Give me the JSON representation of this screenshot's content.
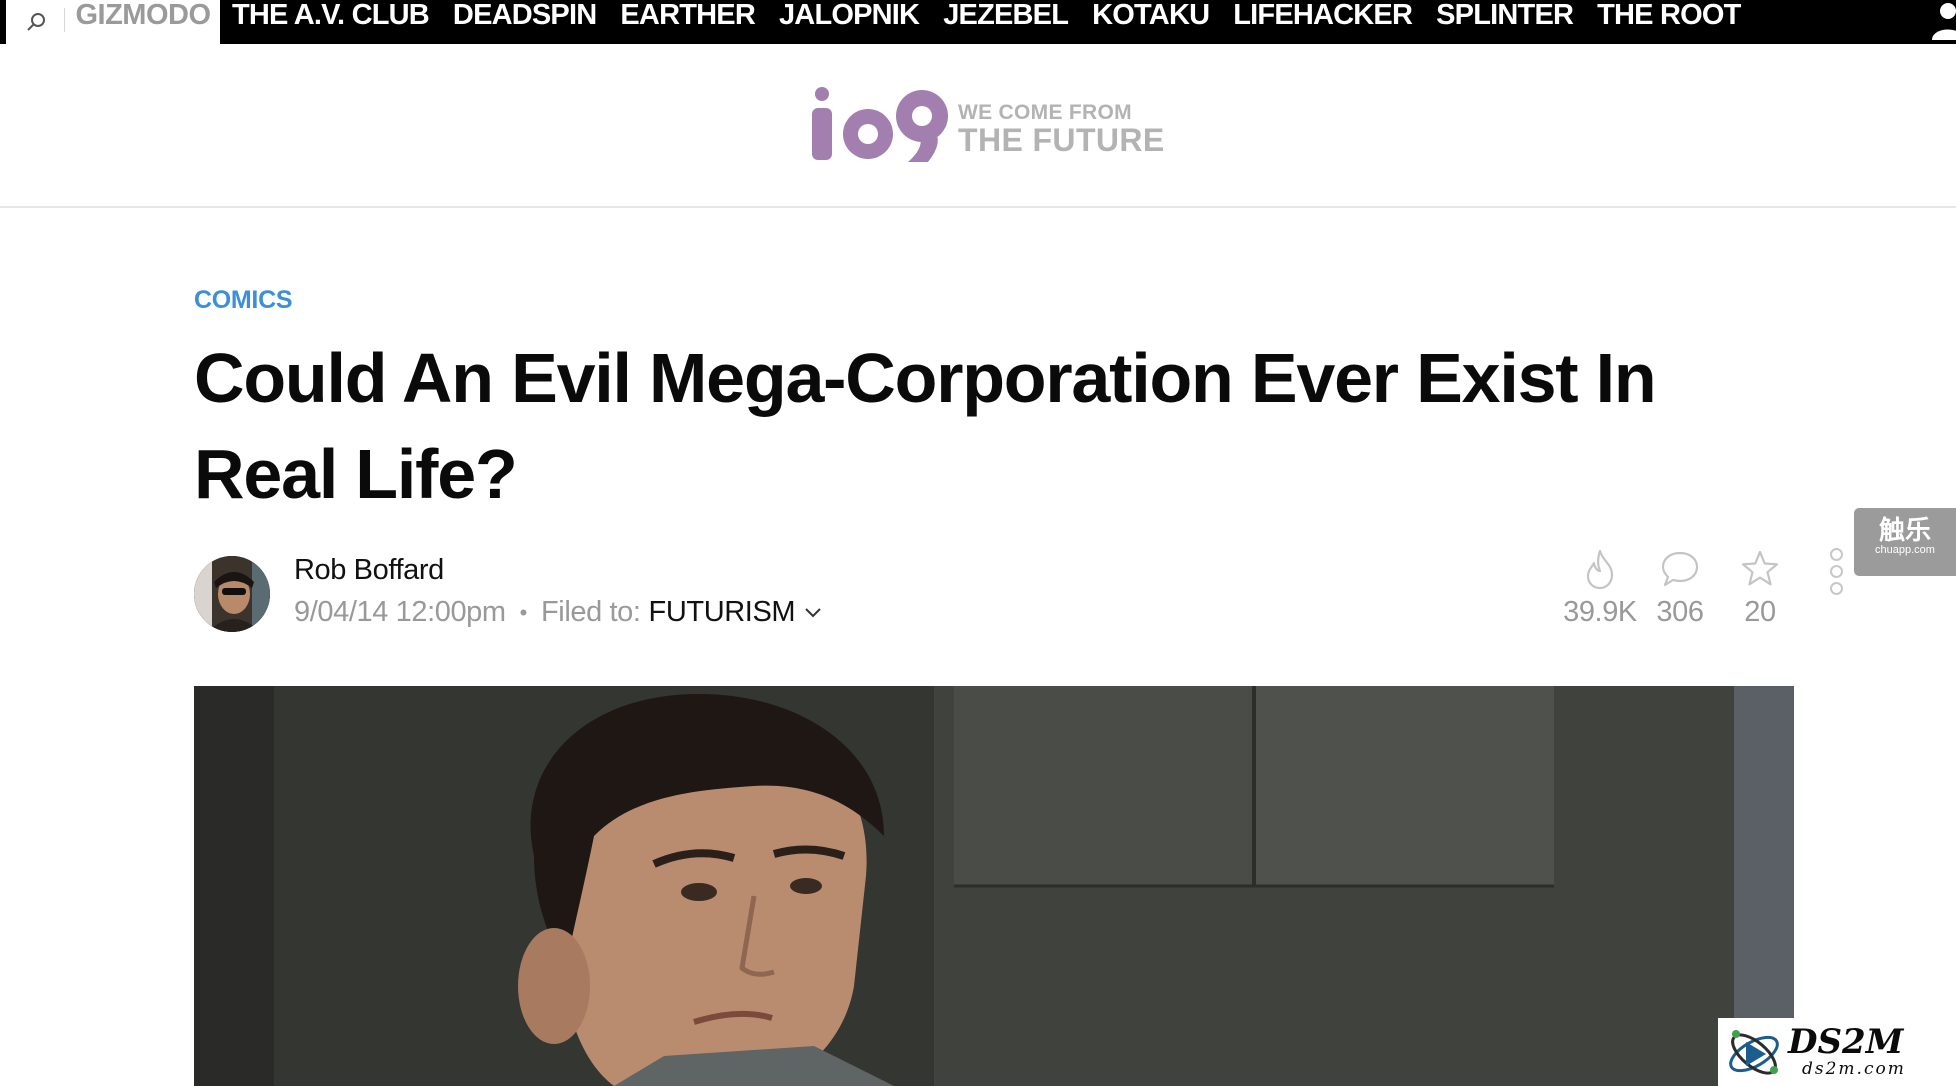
{
  "topnav": {
    "search_icon": "search-icon",
    "current_site": "GIZMODO",
    "sites": [
      "THE A.V. CLUB",
      "DEADSPIN",
      "EARTHER",
      "JALOPNIK",
      "JEZEBEL",
      "KOTAKU",
      "LIFEHACKER",
      "SPLINTER",
      "THE ROOT"
    ],
    "user_icon": "user-icon"
  },
  "brand": {
    "logo_text": "io9",
    "tagline_line1": "WE COME FROM",
    "tagline_line2": "THE FUTURE",
    "logo_color": "#a37fb0",
    "tagline_color": "#b3b3b3"
  },
  "article": {
    "category": "COMICS",
    "category_color": "#3d8fd8",
    "title": "Could An Evil Mega-Corporation Ever Exist In Real Life?",
    "author": "Rob Boffard",
    "date": "9/04/14 12:00pm",
    "filed_label": "Filed to:",
    "filed_value": "FUTURISM",
    "stats": {
      "views": "39.9K",
      "comments": "306",
      "stars": "20"
    }
  },
  "side_badge": {
    "main": "触乐",
    "sub": "chuapp.com"
  },
  "watermark": {
    "main": "DS2M",
    "sub": "ds2m.com"
  }
}
